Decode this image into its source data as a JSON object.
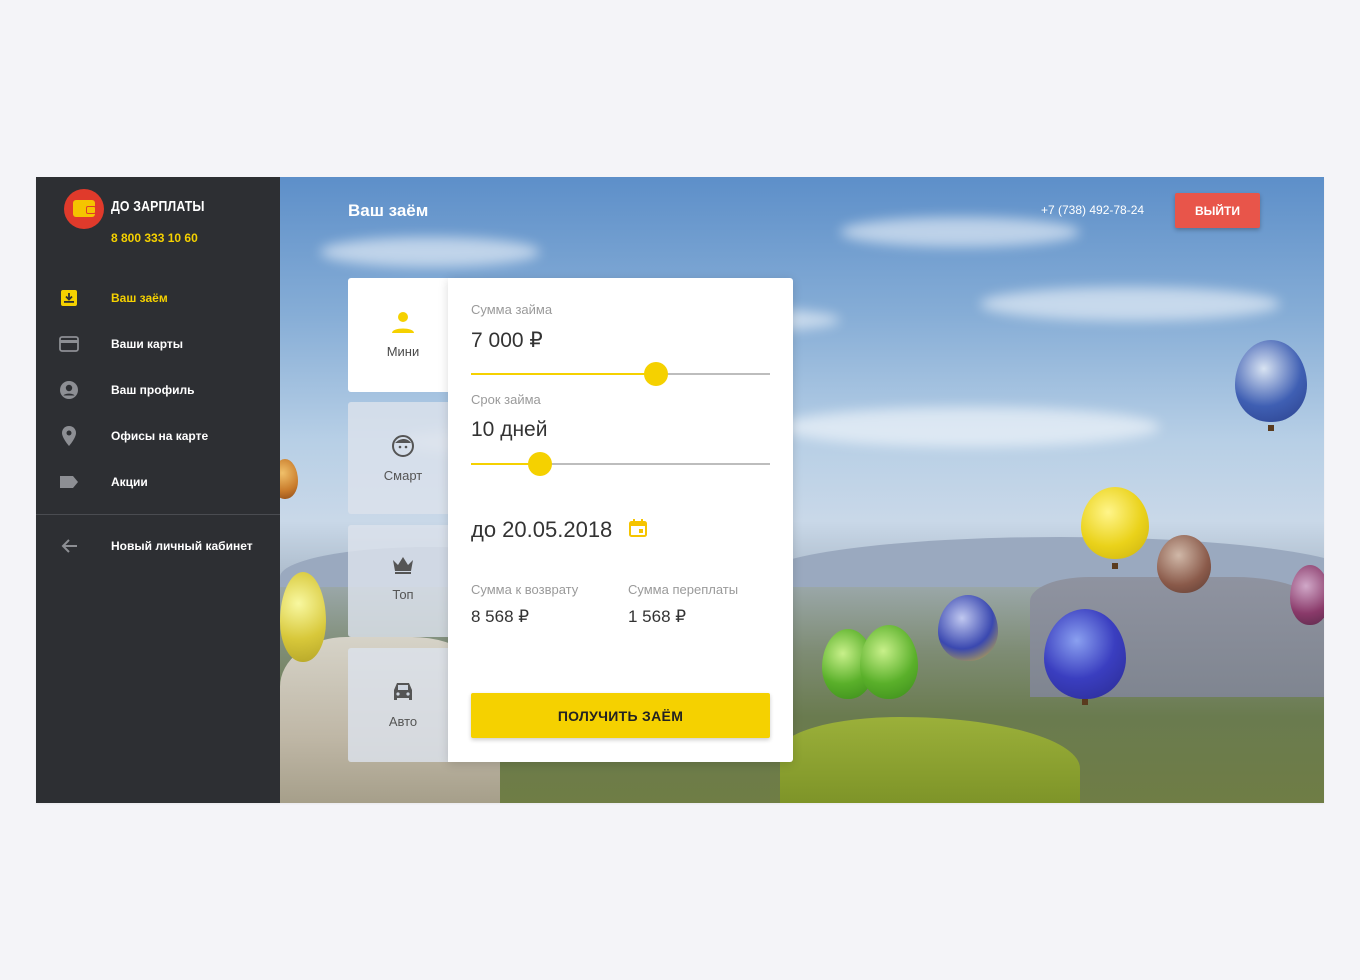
{
  "brand": {
    "name": "ДО ЗАРПЛАТЫ",
    "phone": "8 800 333 10 60"
  },
  "sidebar": {
    "items": [
      {
        "label": "Ваш заём",
        "icon": "download-box-icon"
      },
      {
        "label": "Ваши карты",
        "icon": "credit-card-icon"
      },
      {
        "label": "Ваш профиль",
        "icon": "account-circle-icon"
      },
      {
        "label": "Офисы на карте",
        "icon": "map-pin-icon"
      },
      {
        "label": "Акции",
        "icon": "tag-icon"
      }
    ],
    "extra": {
      "label": "Новый личный кабинет",
      "icon": "arrow-left-icon"
    }
  },
  "header": {
    "title": "Ваш заём",
    "phone": "+7 (738) 492-78-24",
    "logout_label": "ВЫЙТИ"
  },
  "tabs": [
    {
      "label": "Мини",
      "icon": "person-icon"
    },
    {
      "label": "Смарт",
      "icon": "face-icon"
    },
    {
      "label": "Топ",
      "icon": "crown-icon"
    },
    {
      "label": "Авто",
      "icon": "car-icon"
    }
  ],
  "loan": {
    "amount_label": "Сумма займа",
    "amount_value": "7 000 ₽",
    "amount_fraction": 0.62,
    "term_label": "Срок займа",
    "term_value": "10 дней",
    "term_fraction": 0.23,
    "due_date": "до 20.05.2018",
    "repay_label": "Сумма к возврату",
    "repay_value": "8 568 ₽",
    "overpay_label": "Сумма переплаты",
    "overpay_value": "1 568 ₽",
    "cta_label": "ПОЛУЧИТЬ ЗАЁМ"
  },
  "colors": {
    "accent": "#f5d100",
    "sidebar": "#2d2f33",
    "logout": "#e8554a",
    "brand_circle": "#e03a2b"
  }
}
